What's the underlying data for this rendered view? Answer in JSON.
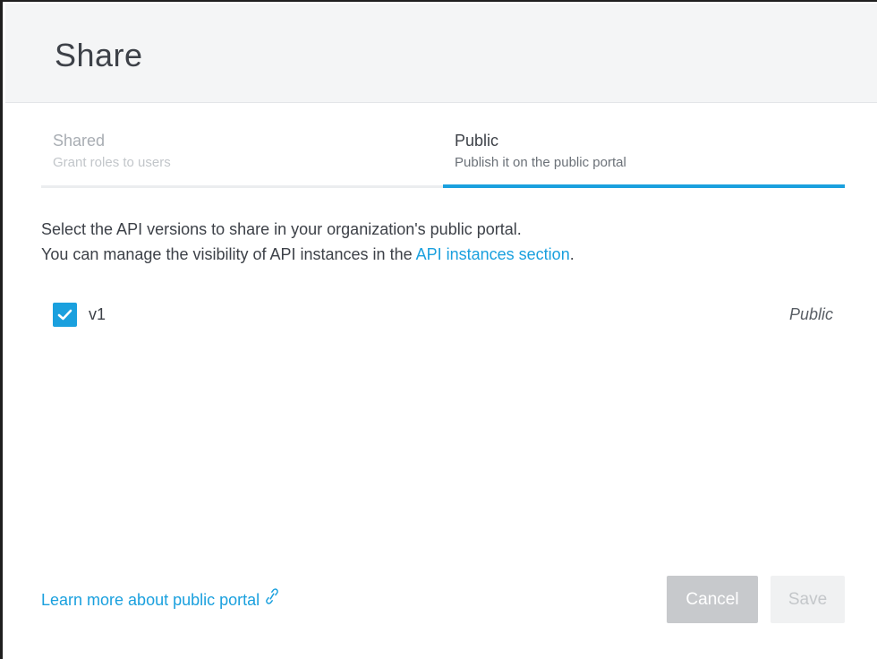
{
  "modal": {
    "title": "Share"
  },
  "tabs": [
    {
      "title": "Shared",
      "subtitle": "Grant roles to users",
      "active": false
    },
    {
      "title": "Public",
      "subtitle": "Publish it on the public portal",
      "active": true
    }
  ],
  "description": {
    "line1": "Select the API versions to share in your organization's public portal.",
    "line2_prefix": "You can manage the visibility of API instances in the ",
    "line2_link": "API instances section",
    "line2_suffix": "."
  },
  "versions": [
    {
      "label": "v1",
      "checked": true,
      "status": "Public"
    }
  ],
  "footer": {
    "learn_more": "Learn more about public portal",
    "link_icon": "external-link-icon",
    "cancel_label": "Cancel",
    "save_label": "Save"
  },
  "colors": {
    "accent": "#1aa0de",
    "header_bg": "#f4f5f6",
    "cancel_bg": "#c7c9cc",
    "save_bg": "#f0f1f2"
  }
}
